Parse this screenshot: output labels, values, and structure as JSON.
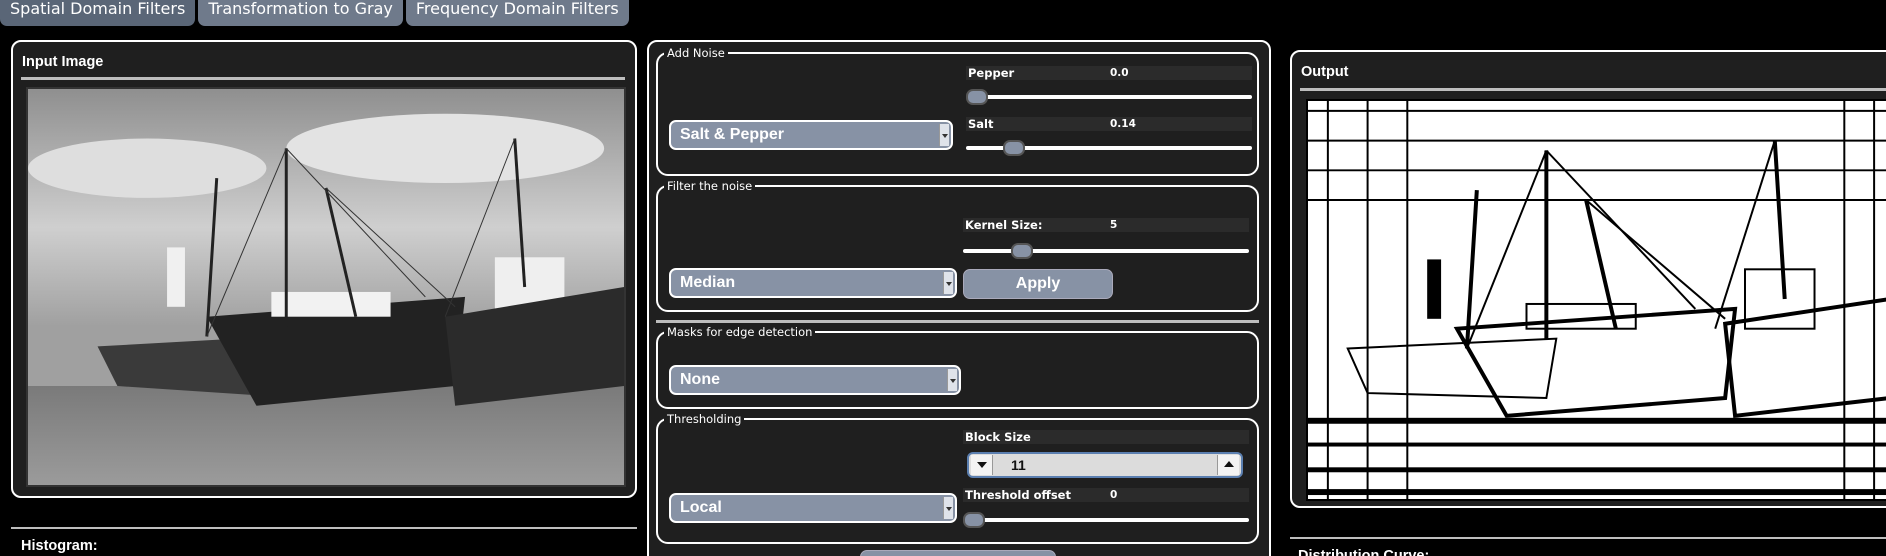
{
  "tabs": [
    {
      "label": "Spatial Domain Filters"
    },
    {
      "label": "Transformation to Gray"
    },
    {
      "label": "Frequency Domain Filters"
    }
  ],
  "input_panel": {
    "title": "Input Image"
  },
  "histogram": {
    "title": "Histogram:"
  },
  "output_panel": {
    "title": "Output"
  },
  "distribution": {
    "title": "Distribution Curve:"
  },
  "add_noise": {
    "legend": "Add Noise",
    "type": "Salt & Pepper",
    "pepper_label": "Pepper",
    "pepper_value": "0.0",
    "pepper_fraction": 0.0,
    "salt_label": "Salt",
    "salt_value": "0.14",
    "salt_fraction": 0.14
  },
  "filter_noise": {
    "legend": "Filter the noise",
    "type": "Median",
    "kernel_label": "Kernel Size:",
    "kernel_value": "5",
    "kernel_fraction": 0.18,
    "apply_label": "Apply"
  },
  "edge_masks": {
    "legend": "Masks for edge detection",
    "type": "None"
  },
  "thresholding": {
    "legend": "Thresholding",
    "type": "Local",
    "block_label": "Block Size",
    "block_value": "11",
    "offset_label": "Threshold offset",
    "offset_value": "0",
    "offset_fraction": 0.0
  },
  "colors": {
    "accent": "#8792a5",
    "panel_bg": "#1f1f1f",
    "tab_bg": "#6f7a8b"
  }
}
